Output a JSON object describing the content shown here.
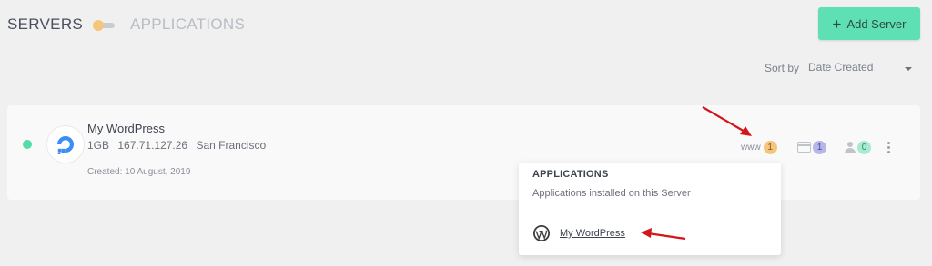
{
  "header": {
    "tab_servers": "SERVERS",
    "tab_applications": "APPLICATIONS",
    "add_server_label": "Add Server"
  },
  "sort": {
    "label": "Sort by",
    "selected": "Date Created"
  },
  "server": {
    "name": "My WordPress",
    "size": "1GB",
    "ip": "167.71.127.26",
    "location": "San Francisco",
    "created": "Created: 10 August, 2019",
    "counters": {
      "www_label": "www",
      "www_count": "1",
      "apps_count": "1",
      "users_count": "0"
    }
  },
  "popover": {
    "title": "APPLICATIONS",
    "subtitle": "Applications installed on this Server",
    "items": [
      {
        "label": "My WordPress"
      }
    ]
  },
  "colors": {
    "accent": "#5fe0b4",
    "status_online": "#52dca6",
    "badge_orange": "#f5c57b",
    "badge_purple": "#b7b6e8",
    "badge_green": "#a9ead2",
    "annotation": "#d3161c"
  },
  "icons": {
    "toggle": "toggle-switch-icon",
    "add": "plus-icon",
    "server_provider": "digitalocean-logo-icon",
    "apps": "application-window-icon",
    "users": "user-icon",
    "more": "kebab-menu-icon",
    "wordpress": "wordpress-logo-icon"
  }
}
